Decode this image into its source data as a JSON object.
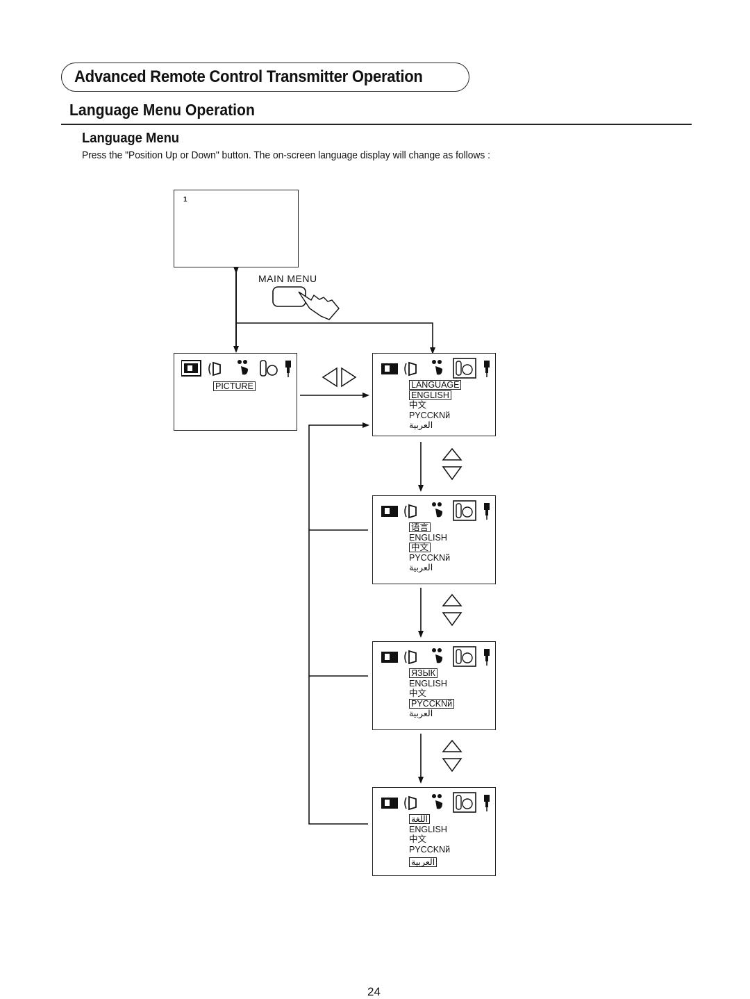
{
  "header": {
    "section_title": "Advanced Remote Control Transmitter Operation",
    "page_title": "Language Menu Operation",
    "subsection_title": "Language Menu",
    "description": "Press the \"Position Up or Down\" button. The on-screen language display will change as follows :"
  },
  "diagram": {
    "tv_screen": {
      "channel_number": "1"
    },
    "main_menu_button_label": "MAIN MENU",
    "main_menu_screen": {
      "icons": [
        "picture-icon",
        "sound-icon",
        "timer-icon",
        "setup-icon",
        "connection-icon"
      ],
      "selected_icon": "picture-icon",
      "highlighted_label": "PICTURE"
    },
    "left_right_buttons": [
      "left-arrow",
      "right-arrow"
    ],
    "up_down_buttons": [
      "up-arrow",
      "down-arrow"
    ],
    "language_screens": [
      {
        "header": "LANGUAGE",
        "options": [
          "ENGLISH",
          "中文",
          "PYCCKNй",
          "العربية"
        ],
        "selected_option": 0
      },
      {
        "header": "语言",
        "options": [
          "ENGLISH",
          "中文",
          "PYCCKNй",
          "العربية"
        ],
        "selected_option": 1
      },
      {
        "header": "ЯЗЫК",
        "options": [
          "ENGLISH",
          "中文",
          "PYCCKNй",
          "العربية"
        ],
        "selected_option": 2
      },
      {
        "header": "اللغة",
        "options": [
          "ENGLISH",
          "中文",
          "PYCCKNй",
          "العربية"
        ],
        "selected_option": 3
      }
    ]
  },
  "footer": {
    "page_number": "24"
  }
}
